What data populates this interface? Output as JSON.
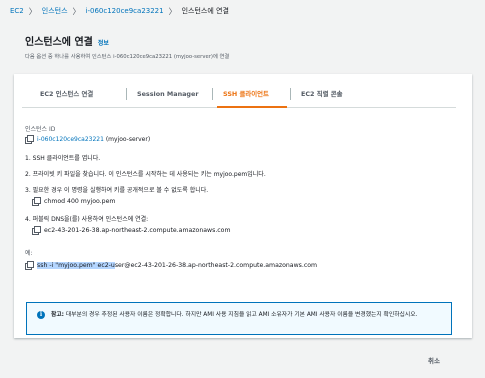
{
  "breadcrumb": {
    "items": [
      "EC2",
      "인스턴스",
      "i-060c120ce9ca23221",
      "인스턴스에 연결"
    ],
    "separator": "〉"
  },
  "header": {
    "title": "인스턴스에 연결",
    "info": "정보",
    "description": "다음 옵션 중 하나를 사용하여 인스턴스 i-060c120ce9ca23221 (myjoo-server)에 연결"
  },
  "tabs": [
    {
      "label": "EC2 인스턴스 연결",
      "active": false
    },
    {
      "label": "Session Manager",
      "active": false
    },
    {
      "label": "SSH 클라이언트",
      "active": true
    },
    {
      "label": "EC2 직렬 콘솔",
      "active": false
    }
  ],
  "instance": {
    "label": "인스턴스 ID",
    "id": "i-060c120ce9ca23221",
    "name": "(myjoo-server)"
  },
  "steps": {
    "s1": "1. SSH 클라이언트를 엽니다.",
    "s2_prefix": "2. 프라이빗 키 파일을 찾습니다. 이 인스턴스를 시작하는 데 사용되는 키는 ",
    "s2_key": "myjoo.pem",
    "s2_suffix": "입니다.",
    "s3": "3. 필요한 경우 이 명령을 실행하여 키를 공개적으로 볼 수 없도록 합니다.",
    "s3_cmd": "chmod 400 myjoo.pem",
    "s4": "4. 퍼블릭 DNS을(를) 사용하여 인스턴스에 연결:",
    "s4_dns": "ec2-43-201-26-38.ap-northeast-2.compute.amazonaws.com"
  },
  "example": {
    "label": "예:",
    "cmd_selected": "ssh -i \"myjoo.pem\" ec2-u",
    "cmd_rest": "ser@ec2-43-201-26-38.ap-northeast-2.compute.amazonaws.com"
  },
  "notice": {
    "icon": "i",
    "bold": "참고:",
    "text": " 대부분의 경우 추정된 사용자 이름은 정확합니다. 하지만 AMI 사용 지침을 읽고 AMI 소유자가 기본 AMI 사용자 이름을 변경했는지 확인하십시오."
  },
  "footer": {
    "cancel": "취소"
  },
  "colors": {
    "link": "#0073bb",
    "active_tab": "#ec7211",
    "notice_bg": "#f1faff",
    "notice_border": "#0073bb",
    "selection": "#b4d5fe"
  }
}
